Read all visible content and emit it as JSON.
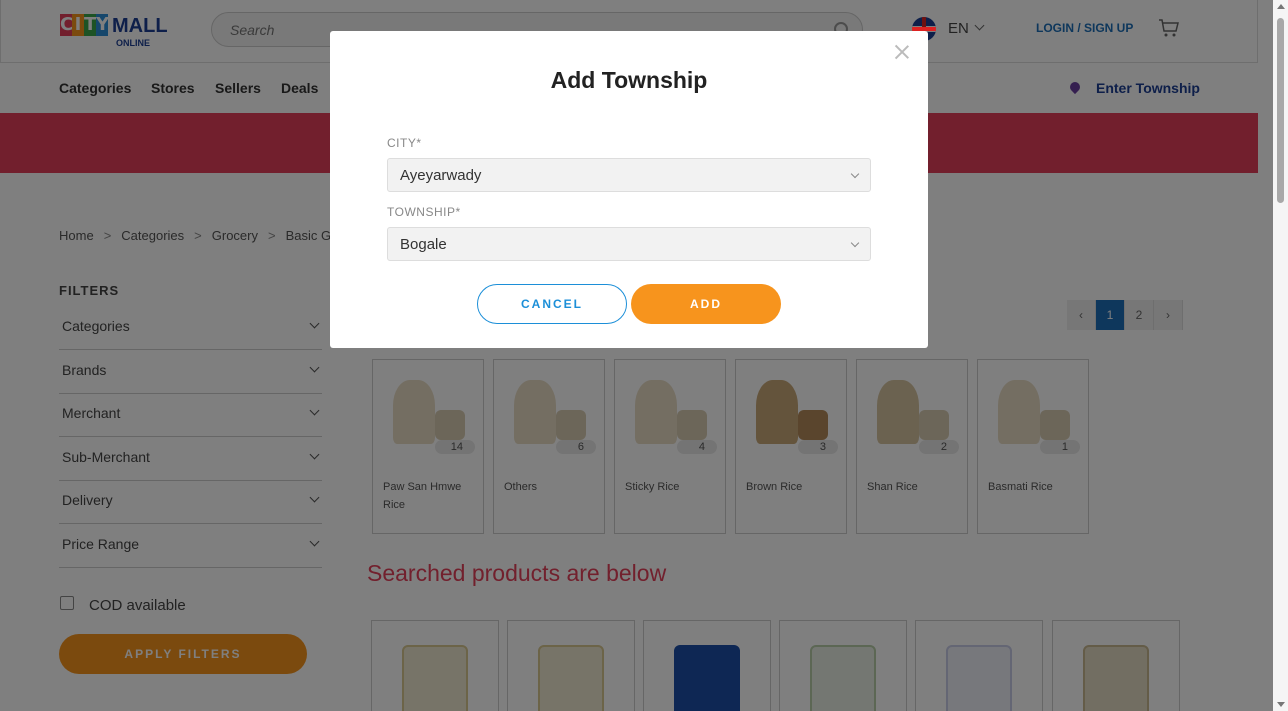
{
  "header": {
    "logo_city": [
      "C",
      "I",
      "T",
      "Y"
    ],
    "logo_mall": "MALL",
    "logo_online": "ONLINE",
    "search_placeholder": "Search",
    "language": "EN",
    "login_label": "LOGIN / SIGN UP"
  },
  "nav": {
    "items": [
      "Categories",
      "Stores",
      "Sellers",
      "Deals"
    ],
    "township_label": "Enter Township"
  },
  "breadcrumb": [
    "Home",
    "Categories",
    "Grocery",
    "Basic G"
  ],
  "filters": {
    "title": "FILTERS",
    "items": [
      "Categories",
      "Brands",
      "Merchant",
      "Sub-Merchant",
      "Delivery",
      "Price Range"
    ],
    "cod_label": "COD available",
    "apply_label": "APPLY FILTERS"
  },
  "pagination": {
    "pages": [
      "1",
      "2"
    ],
    "current": "1"
  },
  "categories": [
    {
      "name": "Paw San Hmwe Rice",
      "count": "14"
    },
    {
      "name": "Others",
      "count": "6"
    },
    {
      "name": "Sticky Rice",
      "count": "4"
    },
    {
      "name": "Brown Rice",
      "count": "3"
    },
    {
      "name": "Shan Rice",
      "count": "2"
    },
    {
      "name": "Basmati Rice",
      "count": "1"
    }
  ],
  "searched_title": "Searched products are below",
  "modal": {
    "title": "Add Township",
    "city_label": "CITY*",
    "city_value": "Ayeyarwady",
    "township_label": "TOWNSHIP*",
    "township_value": "Bogale",
    "cancel_label": "CANCEL",
    "add_label": "ADD"
  },
  "colors": {
    "brand_orange": "#f7941d",
    "banner_red": "#e43f5a",
    "link_blue": "#1c6fb8"
  }
}
